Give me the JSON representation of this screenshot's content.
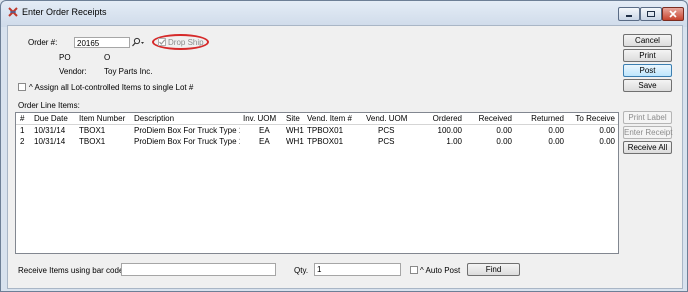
{
  "window": {
    "title": "Enter Order Receipts",
    "min_icon": "minimize-icon",
    "max_icon": "maximize-icon",
    "close_icon": "close-icon"
  },
  "header": {
    "order_label": "Order #:",
    "order_value": "20165",
    "lookup_icon": "magnifier-dropdown-icon",
    "drop_ship_label": "Drop Ship",
    "drop_ship_checked": true,
    "type_value": "PO",
    "status_value": "O",
    "vendor_label": "Vendor:",
    "vendor_value": "Toy Parts Inc.",
    "assign_lot_label": "^ Assign all Lot-controlled Items to single Lot #"
  },
  "order_lines": {
    "label": "Order Line Items:",
    "columns": [
      "#",
      "Due Date",
      "Item Number",
      "Description",
      "Inv. UOM",
      "Site",
      "Vend. Item #",
      "Vend. UOM",
      "Ordered",
      "Received",
      "Returned",
      "To Receive"
    ],
    "rows": [
      [
        "1",
        "10/31/14",
        "TBOX1",
        "ProDiem Box For Truck Type 1",
        "EA",
        "WH1",
        "TPBOX01",
        "PCS",
        "100.00",
        "0.00",
        "0.00",
        "0.00"
      ],
      [
        "2",
        "10/31/14",
        "TBOX1",
        "ProDiem Box For Truck Type 1",
        "EA",
        "WH1",
        "TPBOX01",
        "PCS",
        "1.00",
        "0.00",
        "0.00",
        "0.00"
      ]
    ]
  },
  "buttons": {
    "cancel": "Cancel",
    "print": "Print",
    "post": "Post",
    "save": "Save",
    "print_label": "Print Label",
    "enter_receipt": "Enter Receipt",
    "receive_all": "Receive All",
    "find": "Find"
  },
  "footer": {
    "barcode_label": "Receive Items using bar code:",
    "barcode_value": "",
    "qty_label": "Qty.",
    "qty_value": "1",
    "auto_post_label": "^ Auto Post"
  },
  "colors": {
    "highlight_ring": "#d62a2a",
    "default_button": "#3c7fb1"
  }
}
